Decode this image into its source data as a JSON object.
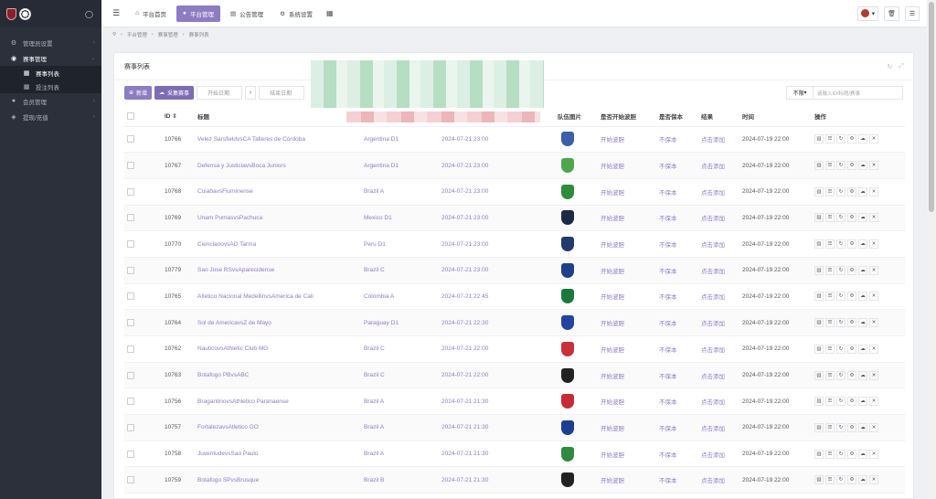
{
  "sidebar": {
    "items": [
      {
        "icon": "wrench-icon",
        "label": "管理员设置"
      },
      {
        "icon": "users-icon",
        "label": "赛事管理"
      },
      {
        "icon": "user-icon",
        "label": "会员管理"
      },
      {
        "icon": "dollar-icon",
        "label": "提现/充值"
      }
    ],
    "sub": [
      {
        "label": "赛事列表"
      },
      {
        "label": "投注列表"
      }
    ]
  },
  "topbar": {
    "tabs": [
      {
        "icon": "home-icon",
        "label": "平台首页"
      },
      {
        "icon": "user-icon",
        "label": "平台管理"
      },
      {
        "icon": "notice-icon",
        "label": "公告管理"
      },
      {
        "icon": "gear-icon",
        "label": "系统设置"
      }
    ]
  },
  "breadcrumb": [
    "平台管理",
    "赛事管理",
    "赛事列表"
  ],
  "panel": {
    "title": "赛事列表",
    "add_label": "新增",
    "collect_label": "采集赛事",
    "start_placeholder": "开始日期",
    "end_placeholder": "结束日期",
    "filter_select": "不限",
    "search_placeholder": "请输入ID/标题/赛事"
  },
  "table": {
    "headers": [
      "ID",
      "标题",
      "队伍图片",
      "是否开始波胆",
      "是否保本",
      "结果",
      "时间",
      "操作"
    ],
    "rows": [
      {
        "id": "10766",
        "title": "Velez SarsfieldvsCA Talleres de Córdoba",
        "league": "Argentina D1",
        "start": "2024-07-21 23:00",
        "bodan": "开始波胆",
        "baoben": "不保本",
        "result": "点击添加",
        "time": "2024-07-19 22:00",
        "c1": "#3c5fa8",
        "c2": "#222"
      },
      {
        "id": "10767",
        "title": "Defensa y JusticiavsBoca Juniors",
        "league": "Argentina D1",
        "start": "2024-07-21 23:00",
        "bodan": "开始波胆",
        "baoben": "不保本",
        "result": "点击添加",
        "time": "2024-07-19 22:00",
        "c1": "#4da64b",
        "c2": "#1b3f8f"
      },
      {
        "id": "10768",
        "title": "CuiabavsFluminense",
        "league": "Brazil A",
        "start": "2024-07-21 23:00",
        "bodan": "开始波胆",
        "baoben": "不保本",
        "result": "点击添加",
        "time": "2024-07-19 22:00",
        "c1": "#2e8b3b",
        "c2": "#9b1e2f"
      },
      {
        "id": "10769",
        "title": "Unam PumasvsPachuca",
        "league": "Mexico D1",
        "start": "2024-07-21 23:00",
        "bodan": "开始波胆",
        "baoben": "不保本",
        "result": "点击添加",
        "time": "2024-07-19 22:00",
        "c1": "#1d2a44",
        "c2": "#a9b3c9"
      },
      {
        "id": "10770",
        "title": "CienclanovsAD Tarma",
        "league": "Peru D1",
        "start": "2024-07-21 23:00",
        "bodan": "开始波胆",
        "baoben": "不保本",
        "result": "点击添加",
        "time": "2024-07-19 22:00",
        "c1": "#233a6b",
        "c2": "#3a8f5a"
      },
      {
        "id": "10779",
        "title": "Sao Jose RSvsAparecidense",
        "league": "Brazil C",
        "start": "2024-07-21 23:00",
        "bodan": "开始波胆",
        "baoben": "不保本",
        "result": "点击添加",
        "time": "2024-07-19 22:00",
        "c1": "#1f3f8a",
        "c2": "#888"
      },
      {
        "id": "10765",
        "title": "Atletico Nacional MedellinvsAmerica de Cali",
        "league": "Colombia A",
        "start": "2024-07-21 22:45",
        "bodan": "开始波胆",
        "baoben": "不保本",
        "result": "点击添加",
        "time": "2024-07-19 22:00",
        "c1": "#1b7a3a",
        "c2": "#c52a2a"
      },
      {
        "id": "10764",
        "title": "Sol de AmericavsZ de Mayo",
        "league": "Paraguay D1",
        "start": "2024-07-21 22:30",
        "bodan": "开始波胆",
        "baoben": "不保本",
        "result": "点击添加",
        "time": "2024-07-19 22:00",
        "c1": "#2244a0",
        "c2": "#1e3f8c"
      },
      {
        "id": "10762",
        "title": "NauticovsAthletic Club MG",
        "league": "Brazil C",
        "start": "2024-07-21 22:00",
        "bodan": "开始波胆",
        "baoben": "不保本",
        "result": "点击添加",
        "time": "2024-07-19 22:00",
        "c1": "#c8303a",
        "c2": "#3da05a"
      },
      {
        "id": "10763",
        "title": "Botafogo PBvsABC",
        "league": "Brazil C",
        "start": "2024-07-21 22:00",
        "bodan": "开始波胆",
        "baoben": "不保本",
        "result": "点击添加",
        "time": "2024-07-19 22:00",
        "c1": "#222",
        "c2": "#111"
      },
      {
        "id": "10756",
        "title": "BragantinovsAthletico Paranaense",
        "league": "Brazil A",
        "start": "2024-07-21 21:30",
        "bodan": "开始波胆",
        "baoben": "不保本",
        "result": "点击添加",
        "time": "2024-07-19 22:00",
        "c1": "#c62b36",
        "c2": "#b4232c"
      },
      {
        "id": "10757",
        "title": "FortalezavsAtletico GO",
        "league": "Brazil A",
        "start": "2024-07-21 21:30",
        "bodan": "开始波胆",
        "baoben": "不保本",
        "result": "点击添加",
        "time": "2024-07-19 22:00",
        "c1": "#1d3f8f",
        "c2": "#c22"
      },
      {
        "id": "10758",
        "title": "JuventudevsSao Paulo",
        "league": "Brazil A",
        "start": "2024-07-21 21:30",
        "bodan": "开始波胆",
        "baoben": "不保本",
        "result": "点击添加",
        "time": "2024-07-19 22:00",
        "c1": "#2e8a3e",
        "c2": "#c22"
      },
      {
        "id": "10759",
        "title": "Botafogo SPvsBrusque",
        "league": "Brazil B",
        "start": "2024-07-21 21:30",
        "bodan": "开始波胆",
        "baoben": "不保本",
        "result": "点击添加",
        "time": "2024-07-19 22:00",
        "c1": "#222",
        "c2": "#d8a82a"
      }
    ]
  }
}
